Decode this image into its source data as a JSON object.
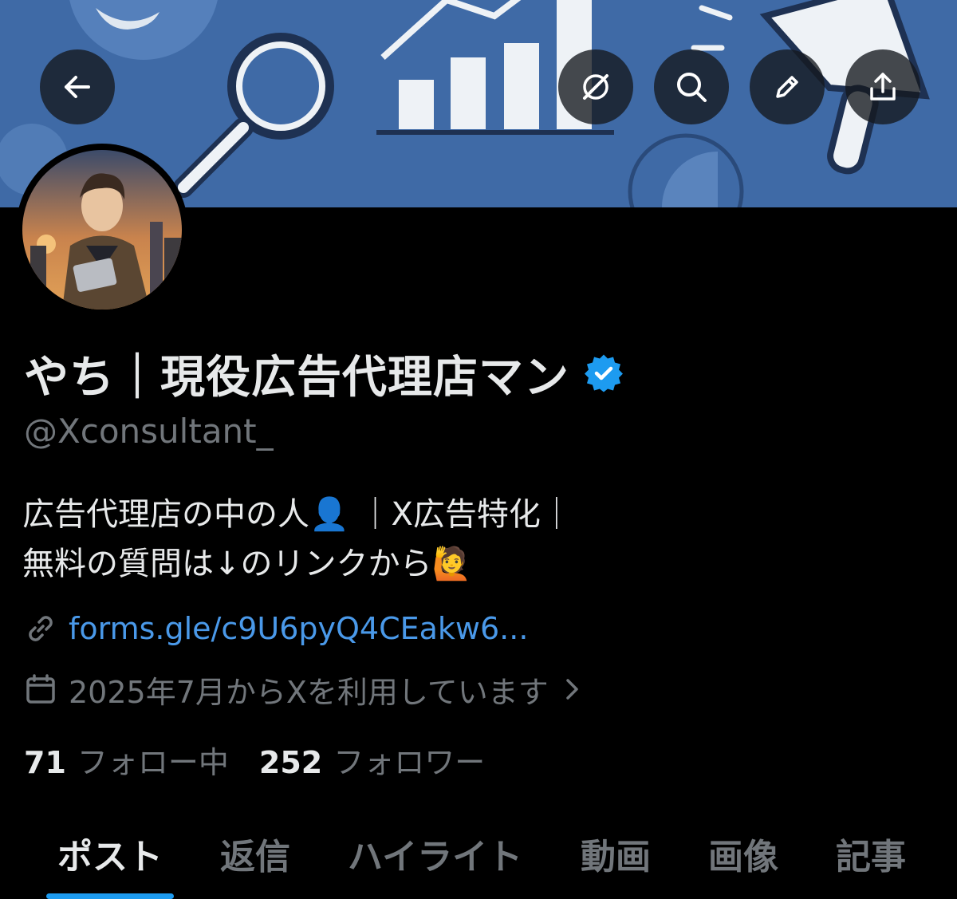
{
  "header": {
    "back_icon": "arrow-left-icon",
    "actions": [
      "grok-icon",
      "search-icon",
      "pencil-icon",
      "share-icon"
    ]
  },
  "profile": {
    "display_name": "やち｜現役広告代理店マン",
    "verified": true,
    "handle": "@Xconsultant_",
    "bio_lines": [
      "広告代理店の中の人👤 ｜X広告特化｜",
      "無料の質問は↓のリンクから🙋"
    ],
    "link": "forms.gle/c9U6pyQ4CEakw6...",
    "joined": "2025年7月からXを利用しています",
    "following_count": "71",
    "following_label": "フォロー中",
    "followers_count": "252",
    "followers_label": "フォロワー"
  },
  "tabs": [
    {
      "label": "ポスト",
      "active": true
    },
    {
      "label": "返信",
      "active": false
    },
    {
      "label": "ハイライト",
      "active": false
    },
    {
      "label": "動画",
      "active": false
    },
    {
      "label": "画像",
      "active": false
    },
    {
      "label": "記事",
      "active": false
    }
  ],
  "colors": {
    "background": "#000000",
    "text_primary": "#e7e9ea",
    "text_secondary": "#71767b",
    "link": "#4a99e9",
    "accent": "#1d9bf0",
    "banner": "#3f6aa6"
  }
}
